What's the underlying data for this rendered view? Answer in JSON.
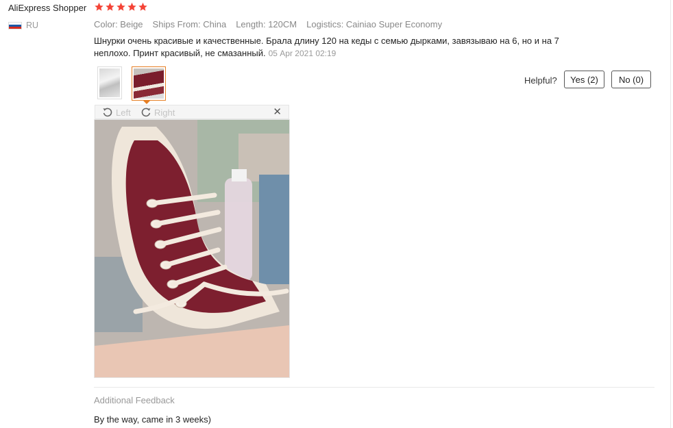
{
  "user": {
    "name": "AliExpress Shopper",
    "country": "RU",
    "flag_icon": "russia-flag-icon"
  },
  "rating": {
    "stars": 5,
    "max": 5,
    "color": "#f44336"
  },
  "attributes": [
    "Color: Beige",
    "Ships From: China",
    "Length: 120CM",
    "Logistics: Cainiao Super Economy"
  ],
  "review": {
    "text": "Шнурки очень красивые и качественные. Брала длину 120 на кеды с семью дырками, завязываю на 6, но и на 7 неплохо. Принт красивый, не смазанный.",
    "date": "05 Apr 2021 02:19"
  },
  "helpful": {
    "label": "Helpful?",
    "yes": "Yes (2)",
    "no": "No (0)"
  },
  "viewer": {
    "rotate_left": "Left",
    "rotate_right": "Right",
    "close_icon": "close-icon"
  },
  "additional_feedback": {
    "title": "Additional Feedback",
    "text": "By the way, came in 3 weeks)"
  },
  "colors": {
    "accent": "#e67e22",
    "muted": "#999999"
  }
}
